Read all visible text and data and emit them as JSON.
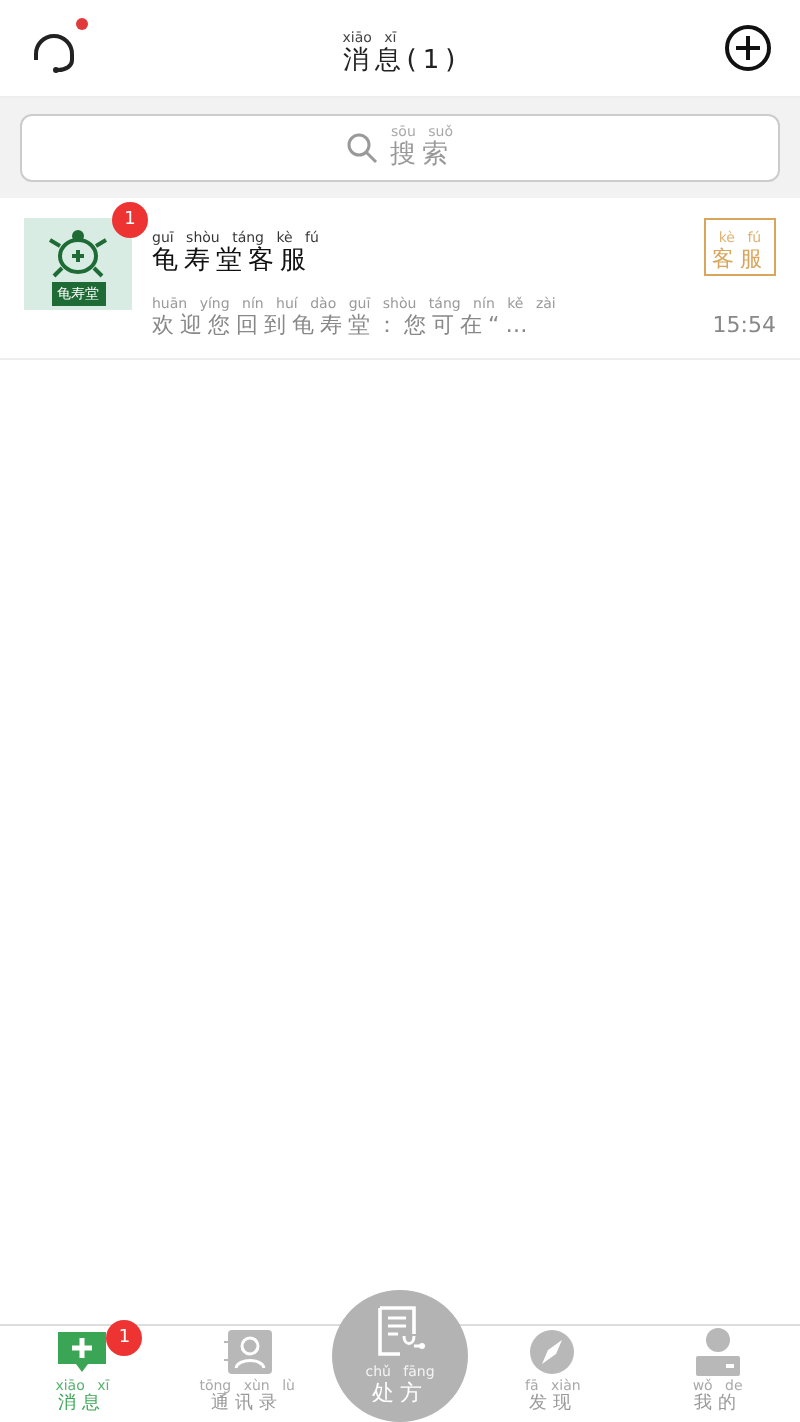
{
  "header": {
    "title": {
      "text": "消息(1)",
      "pinyin": "xiāo xī"
    },
    "headset_badge": true
  },
  "search": {
    "placeholder": {
      "text": "搜索",
      "pinyin": "sōu suǒ"
    }
  },
  "conversations": [
    {
      "name": {
        "text": "龟寿堂客服",
        "pinyin": "guī shòu táng kè fú"
      },
      "logo_text": "龟寿堂",
      "unread": "1",
      "tag": {
        "text": "客服",
        "pinyin": "kè fú"
      },
      "preview": {
        "text": "欢迎您回到龟寿堂：您可在“…",
        "pinyin": "huān yíng nín huí dào guī shòu táng nín kě zài"
      },
      "time": "15:54"
    }
  ],
  "tabs": [
    {
      "kind": "chat",
      "label": {
        "text": "消息",
        "pinyin": "xiāo xī"
      },
      "selected": true,
      "badge": "1"
    },
    {
      "kind": "contacts",
      "label": {
        "text": "通讯录",
        "pinyin": "tōng xùn lù"
      },
      "selected": false
    },
    {
      "kind": "prescription",
      "label": {
        "text": "处方",
        "pinyin": "chǔ fāng"
      },
      "selected": false
    },
    {
      "kind": "discover",
      "label": {
        "text": "发现",
        "pinyin": "fā xiàn"
      },
      "selected": false
    },
    {
      "kind": "profile",
      "label": {
        "text": "我的",
        "pinyin": "wǒ de"
      },
      "selected": false
    }
  ]
}
